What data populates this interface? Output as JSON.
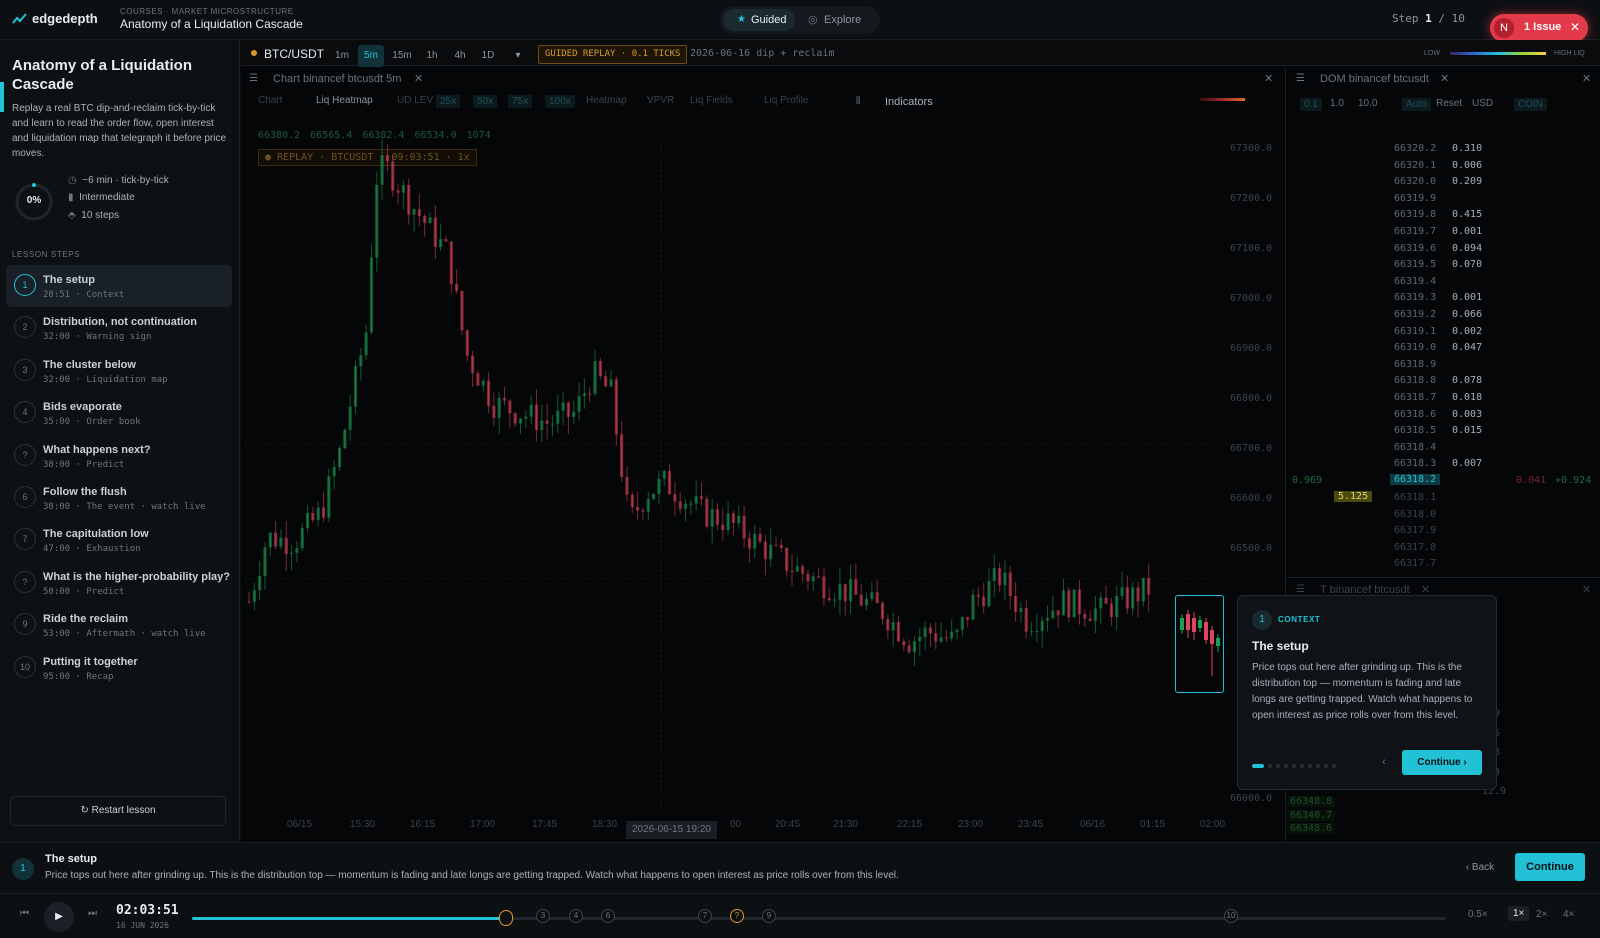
{
  "app": {
    "brand": "edgedepth",
    "breadcrumb": "COURSES · MARKET MICROSTRUCTURE",
    "title": "Anatomy of a Liquidation Cascade"
  },
  "modes": {
    "guided": "Guided",
    "explore": "Explore"
  },
  "stepper": {
    "label": "Step",
    "current": "1",
    "sep": "/",
    "total": "10"
  },
  "issue": {
    "avatar": "N",
    "label": "1 Issue"
  },
  "lesson": {
    "title": "Anatomy of a Liquidation Cascade",
    "description": "Replay a real BTC dip-and-reclaim tick-by-tick and learn to read the order flow, open interest and liquidation map that telegraph it before price moves.",
    "progress": "0%",
    "progress_value": 0,
    "meta": [
      "~6 min · tick-by-tick",
      "Intermediate",
      "10 steps"
    ],
    "steps_header": "LESSON STEPS",
    "restart": "Restart lesson"
  },
  "steps": [
    {
      "n": "1",
      "title": "The setup",
      "sub": "28:51 · Context"
    },
    {
      "n": "2",
      "title": "Distribution, not continuation",
      "sub": "32:00 · Warning sign"
    },
    {
      "n": "3",
      "title": "The cluster below",
      "sub": "32:00 · Liquidation map"
    },
    {
      "n": "4",
      "title": "Bids evaporate",
      "sub": "35:00 · Order book"
    },
    {
      "n": "?",
      "title": "What happens next?",
      "sub": "38:00 · Predict"
    },
    {
      "n": "6",
      "title": "Follow the flush",
      "sub": "38:00 · The event · watch live"
    },
    {
      "n": "7",
      "title": "The capitulation low",
      "sub": "47:00 · Exhaustion"
    },
    {
      "n": "?",
      "title": "What is the higher-probability play?",
      "sub": "50:00 · Predict"
    },
    {
      "n": "9",
      "title": "Ride the reclaim",
      "sub": "53:00 · Aftermath · watch live"
    },
    {
      "n": "10",
      "title": "Putting it together",
      "sub": "95:00 · Recap"
    }
  ],
  "toolbar": {
    "symbol": "BTC/USDT",
    "timeframes": [
      "1m",
      "5m",
      "15m",
      "1h",
      "4h",
      "1D"
    ],
    "more": "▾",
    "replay_badge": "GUIDED REPLAY · 0.1 TICKS",
    "scenario": "2026-06-16 dip + reclaim",
    "liq_low": "LOW",
    "liq_high": "HIGH LIQ"
  },
  "chart_panel": {
    "title": "Chart binancef btcusdt 5m",
    "tabs": [
      "Chart",
      "Liq Heatmap",
      "UD LEV",
      "25x",
      "50x",
      "75x",
      "100x",
      "Heatmap",
      "VPVR",
      "Liq Fields",
      "Liq Profile"
    ],
    "indicators": "Indicators",
    "ohlc": [
      "66380.2",
      "66565.4",
      "66382.4",
      "66534.0",
      "1074"
    ],
    "replay_status": "● REPLAY · BTCUSDT · 09:03:51 · 1x",
    "y_ticks": [
      "67300.0",
      "67200.0",
      "67100.0",
      "67000.0",
      "66900.0",
      "66800.0",
      "66700.0",
      "66600.0",
      "66500.0",
      "66000.0"
    ],
    "x_ticks": [
      "06/15",
      "15:30",
      "16:15",
      "17:00",
      "17:45",
      "18:30",
      "00",
      "20:45",
      "21:30",
      "22:15",
      "23:00",
      "23:45",
      "06/16",
      "01:15",
      "02:00"
    ],
    "cursor_time": "2026-06-15 19:20"
  },
  "chart_data": {
    "type": "candlestick",
    "y_range": [
      66000,
      67330
    ],
    "ohlc_sample": [
      66380.2,
      66565.4,
      66382.4,
      66534.0
    ]
  },
  "dom": {
    "title": "DOM binancef btcusdt",
    "controls": [
      "0.1",
      "1.0",
      "10.0",
      "Auto",
      "Reset",
      "USD",
      "COIN"
    ],
    "rows": [
      {
        "p": "66320.2",
        "s": "0.310"
      },
      {
        "p": "66320.1",
        "s": "0.006"
      },
      {
        "p": "66320.0",
        "s": "0.209"
      },
      {
        "p": "66319.9",
        "s": ""
      },
      {
        "p": "66319.8",
        "s": "0.415"
      },
      {
        "p": "66319.7",
        "s": "0.001"
      },
      {
        "p": "66319.6",
        "s": "0.094"
      },
      {
        "p": "66319.5",
        "s": "0.070"
      },
      {
        "p": "66319.4",
        "s": ""
      },
      {
        "p": "66319.3",
        "s": "0.001"
      },
      {
        "p": "66319.2",
        "s": "0.066"
      },
      {
        "p": "66319.1",
        "s": "0.002"
      },
      {
        "p": "66319.0",
        "s": "0.047"
      },
      {
        "p": "66318.9",
        "s": ""
      },
      {
        "p": "66318.8",
        "s": "0.078"
      },
      {
        "p": "66318.7",
        "s": "0.018"
      },
      {
        "p": "66318.6",
        "s": "0.003"
      },
      {
        "p": "66318.5",
        "s": "0.015"
      },
      {
        "p": "66318.4",
        "s": ""
      },
      {
        "p": "66318.3",
        "s": "0.007"
      }
    ],
    "mid_price": "66318.2",
    "mid_left": "0.969",
    "mid_right_a": "0.041",
    "mid_right_b": "+0.924",
    "bid_size": "5.125",
    "bid_rows": [
      "66318.1",
      "66318.0",
      "66317.9",
      "66317.8",
      "66317.7"
    ]
  },
  "tape": {
    "title": "T binancef btcusdt",
    "values": [
      "5.9",
      "5.5",
      "7.8",
      "9.3",
      "12.9"
    ],
    "prices": [
      "66348.8",
      "66348.7",
      "66348.6"
    ]
  },
  "coach": {
    "n": "1",
    "kind": "CONTEXT",
    "title": "The setup",
    "body": "Price tops out here after grinding up. This is the distribution top — momentum is fading and late longs are getting trapped. Watch what happens to open interest as price rolls over from this level.",
    "continue": "Continue",
    "continue_arrow": "›",
    "back_arrow": "‹",
    "dots_total": 10,
    "dots_active": 1
  },
  "footer": {
    "n": "1",
    "title": "The setup",
    "body": "Price tops out here after grinding up. This is the distribution top — momentum is fading and late longs are getting trapped. Watch what happens to open interest as price rolls over from this level.",
    "back": "‹ Back",
    "continue": "Continue"
  },
  "player": {
    "time": "02:03:51",
    "date": "16 JUN 2026",
    "progress": 0.25,
    "markers": [
      "3",
      "4",
      "6",
      "7",
      "?",
      "9",
      "10"
    ],
    "rates": [
      "0.5×",
      "1×",
      "2×",
      "4×"
    ],
    "active_rate": "1×"
  },
  "colors": {
    "accent": "#22c1d6",
    "up": "#1f9d57",
    "down": "#e0455f",
    "issue": "#e23a4a",
    "amber": "#d99a2b"
  }
}
